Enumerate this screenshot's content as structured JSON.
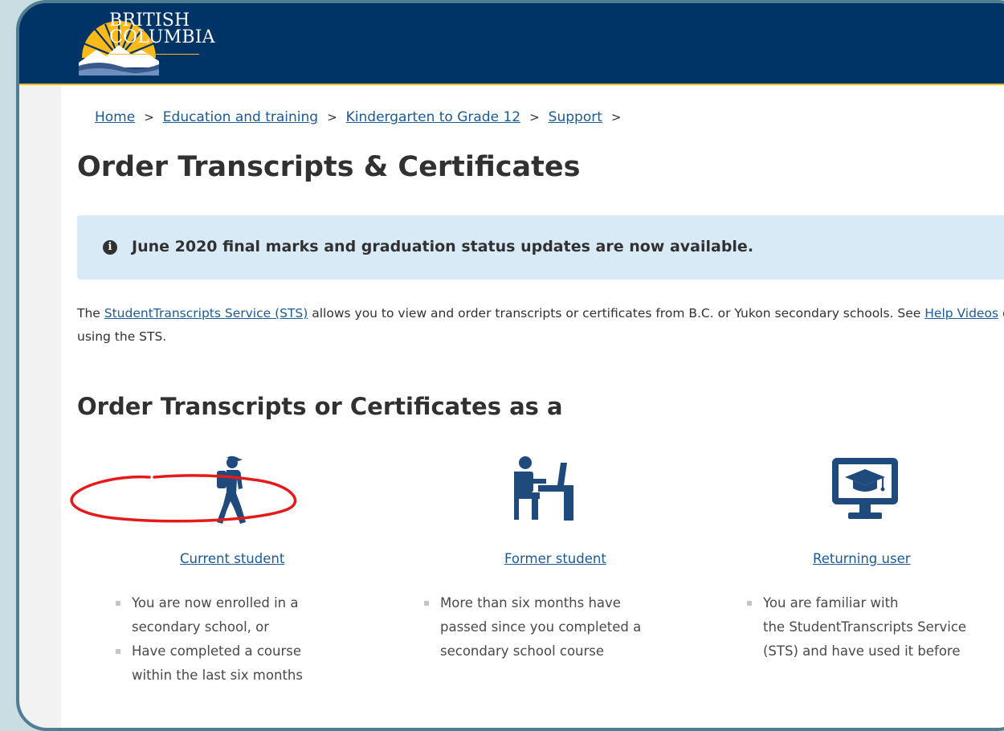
{
  "header": {
    "logo_line1": "BRITISH",
    "logo_line2": "COLUMBIA",
    "logo_icon": "bc-sun-mountain-logo"
  },
  "breadcrumb": {
    "items": [
      "Home",
      "Education and training",
      "Kindergarten to Grade 12",
      "Support"
    ],
    "separator": ">"
  },
  "page": {
    "title": "Order Transcripts & Certificates",
    "alert": "June 2020 final marks and graduation status updates are now available.",
    "alert_icon": "info-icon",
    "intro_prefix": "The ",
    "intro_link": "StudentTranscripts Service (STS)",
    "intro_middle": " allows you to view and order transcripts or certificates from B.C. or Yukon secondary schools.  See ",
    "intro_link2": "Help Videos",
    "intro_suffix": " on using the STS.",
    "subtitle": "Order Transcripts or Certificates as a"
  },
  "options": [
    {
      "icon": "walking-student-icon",
      "label": "Current student",
      "bullets": [
        "You are now enrolled in a",
        "secondary school, or",
        "Have completed a course",
        "within the last six months"
      ]
    },
    {
      "icon": "desk-student-icon",
      "label": "Former student",
      "bullets": [
        "More than six months have",
        "passed since you completed a",
        "secondary school course"
      ]
    },
    {
      "icon": "graduation-monitor-icon",
      "label": "Returning user",
      "bullets": [
        "You are familiar with",
        "the StudentTranscripts Service",
        "(STS) and have used it before"
      ]
    }
  ],
  "colors": {
    "header_bg": "#003366",
    "accent_gold": "#fcba19",
    "link": "#1a5a96",
    "alert_bg": "#d9eaf7",
    "annotation": "#e41b1b"
  }
}
